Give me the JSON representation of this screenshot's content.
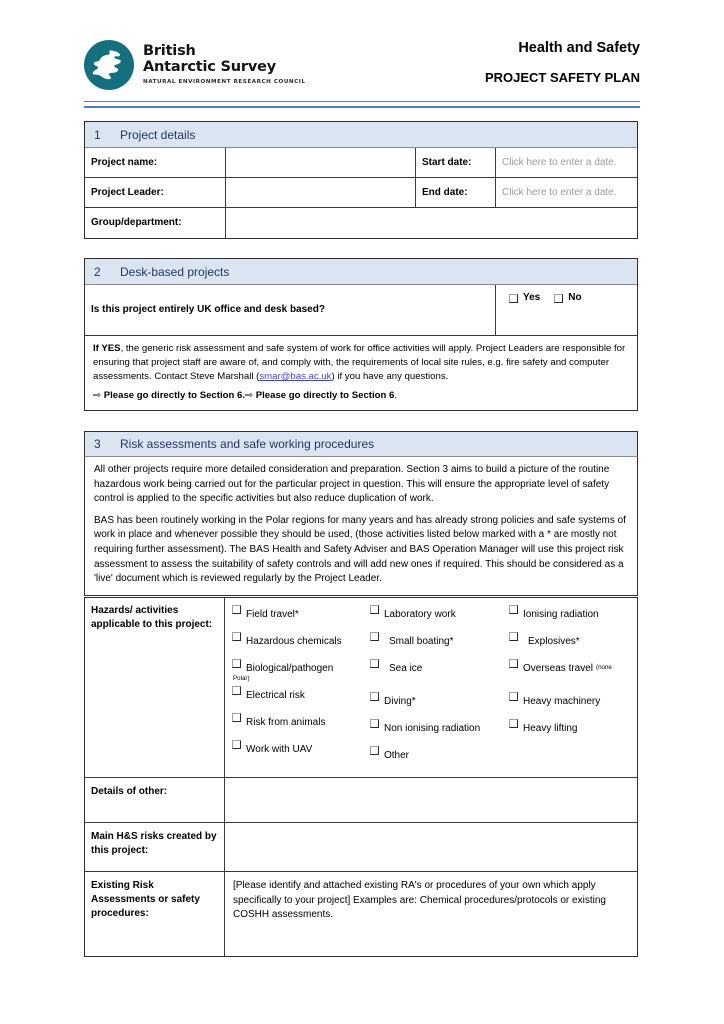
{
  "header": {
    "logo": {
      "line1": "British",
      "line2": "Antarctic Survey",
      "subtitle": "NATURAL ENVIRONMENT RESEARCH COUNCIL",
      "color": "#14707f"
    },
    "title": "Health and Safety",
    "subtitle": "PROJECT SAFETY PLAN",
    "rule_color": "#4f81bd"
  },
  "section1": {
    "number": "1",
    "title": "Project details",
    "rows": [
      {
        "label": "Project name:",
        "value": "",
        "label2": "Start date:",
        "value2": "Click here to enter a date."
      },
      {
        "label": "Project Leader:",
        "value": "",
        "label2": "End date:",
        "value2": "Click here to enter a date."
      },
      {
        "label": "Group/department:",
        "value": ""
      }
    ]
  },
  "section2": {
    "number": "2",
    "title": "Desk-based projects",
    "question": "Is this project entirely UK office and desk based?",
    "yes_label": "Yes",
    "no_label": "No",
    "note_bold": "If YES",
    "note_part1": ", the generic risk assessment and safe system of work for office activities will apply. Project Leaders are responsible for ensuring that project staff are aware of, and comply with, the requirements of local site rules, e.g. fire safety and computer assessments. Contact Steve Marshall (",
    "note_link": "smar@bas.ac.uk",
    "note_part2": ") if you have any questions.",
    "arrow": "⇨",
    "goto_bold": "Please go directly to Section 6",
    "goto_tail": ".",
    "goto_bold2": "Please go directly to Section 6",
    "goto_tail2": "."
  },
  "section3": {
    "number": "3",
    "title": "Risk assessments and safe working procedures",
    "paragraph1": "All other projects require more detailed consideration and preparation. Section 3 aims to build a picture of the routine hazardous work being carried out for the particular project in question. This will ensure the appropriate level of safety control is applied to the specific activities but also reduce duplication of work.",
    "paragraph2": "BAS has been routinely working in the Polar regions for many years and has already strong policies and safe systems of work in place and whenever possible they should be used, (those activities listed below marked with a * are mostly not requiring further assessment). The BAS Health and Safety Adviser and BAS Operation Manager will use this project risk assessment to assess the suitability of safety controls and will add new ones if required. This should be considered as a 'live' document which is reviewed regularly by the Project Leader.",
    "hazards_label": "Hazards/ activities applicable to this project:",
    "hazards_col1": [
      {
        "label": "Field travel*"
      },
      {
        "label": "Hazardous chemicals"
      },
      {
        "label": "Biological/pathogen",
        "tail": "Polar)"
      },
      {
        "label": "Electrical risk"
      },
      {
        "label": "Risk from animals"
      },
      {
        "label": "Work with UAV"
      }
    ],
    "hazards_col2": [
      {
        "label": "Laboratory work"
      },
      {
        "label": "Small boating*"
      },
      {
        "label": "Sea ice"
      },
      {
        "label": "Diving*"
      },
      {
        "label": "Non ionising radiation"
      },
      {
        "label": "Other"
      }
    ],
    "hazards_col3": [
      {
        "label": "Ionising radiation"
      },
      {
        "label": "Explosives*"
      },
      {
        "label": "Overseas travel",
        "small": "(none"
      },
      {
        "label": "Heavy machinery"
      },
      {
        "label": "Heavy lifting"
      }
    ],
    "details_other_label": "Details of other:",
    "details_other_value": "",
    "main_risks_label": "Main H&S risks created by this project:",
    "main_risks_value": "",
    "existing_ra_label": "Existing Risk Assessments or safety procedures:",
    "existing_ra_value": "[Please identify and attached existing RA's or procedures of your own which apply specifically to your project] Examples are: Chemical procedures/protocols or existing COSHH assessments."
  }
}
